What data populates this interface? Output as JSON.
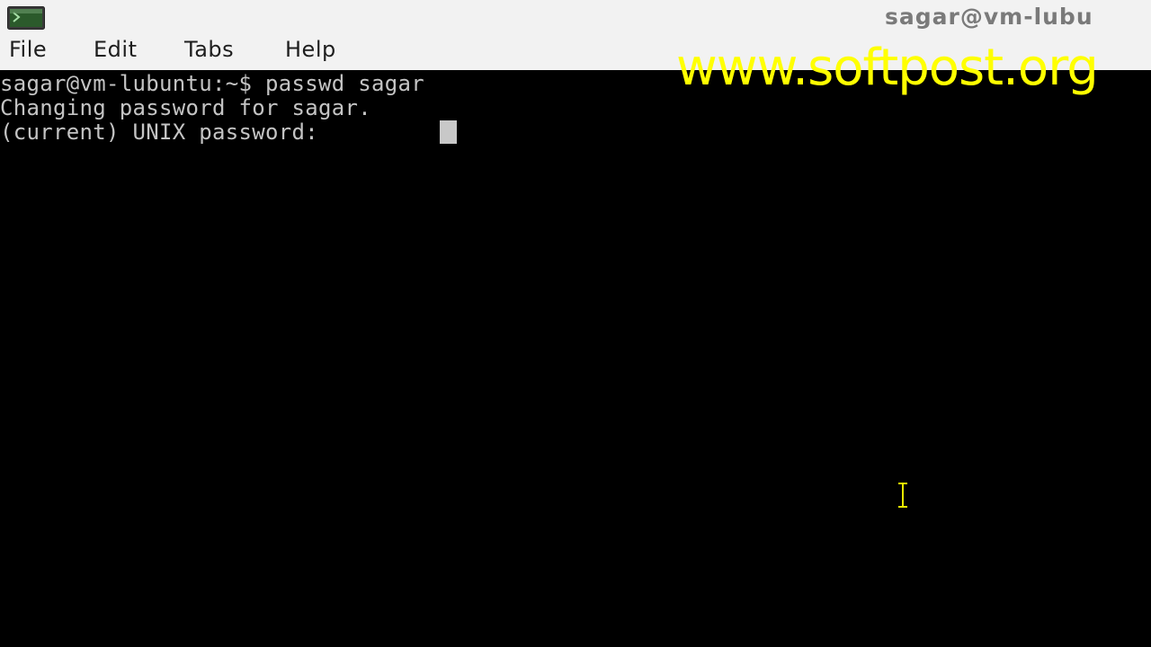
{
  "window": {
    "title": "sagar@vm-lubu",
    "app_icon": "terminal-icon"
  },
  "menubar": {
    "items": [
      {
        "label": "File"
      },
      {
        "label": "Edit"
      },
      {
        "label": "Tabs"
      },
      {
        "label": "Help"
      }
    ]
  },
  "terminal": {
    "lines": [
      "sagar@vm-lubuntu:~$ passwd sagar",
      "Changing password for sagar.",
      "(current) UNIX password: "
    ]
  },
  "watermark": {
    "text": "www.softpost.org"
  },
  "colors": {
    "terminal_bg": "#000000",
    "terminal_fg": "#c4c4c4",
    "menubar_bg": "#f2f2f2",
    "watermark": "#ffff00"
  },
  "icons": {
    "mouse_cursor": "text-ibeam-cursor-icon"
  }
}
